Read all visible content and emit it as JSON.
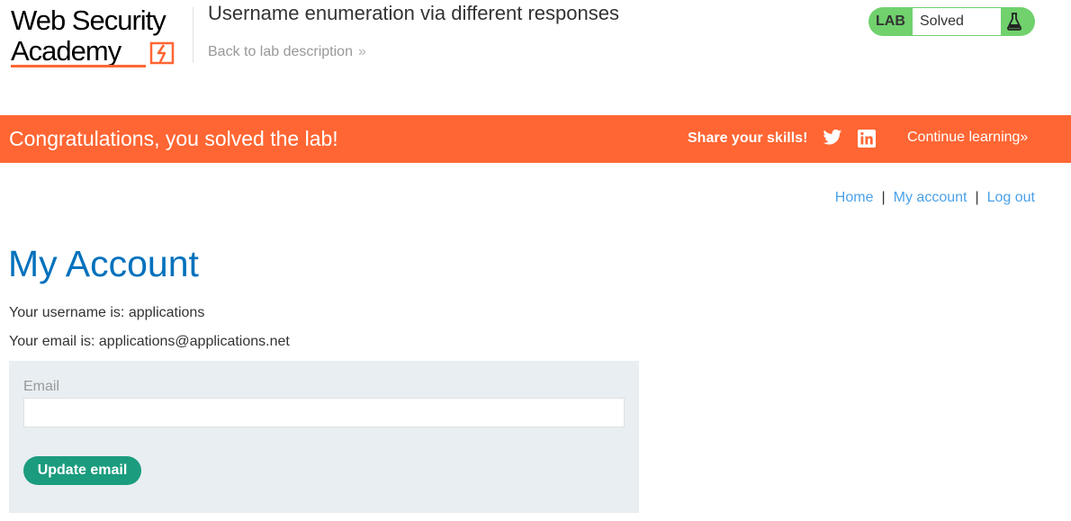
{
  "header": {
    "logo_line1": "Web Security",
    "logo_line2": "Academy",
    "lab_title": "Username enumeration via different responses",
    "back_link": "Back to lab description",
    "back_chevron": "»",
    "lab_status": {
      "tag": "LAB",
      "state": "Solved",
      "icon": "flask-icon"
    }
  },
  "banner": {
    "message": "Congratulations, you solved the lab!",
    "share_label": "Share your skills!",
    "icons": [
      "twitter-icon",
      "linkedin-icon"
    ],
    "continue_label": "Continue learning",
    "continue_chevron": "»"
  },
  "nav": {
    "home": "Home",
    "my_account": "My account",
    "logout": "Log out",
    "separator": "|"
  },
  "main": {
    "title": "My Account",
    "username_text": "Your username is: applications",
    "email_text": "Your email is: applications@applications.net",
    "form": {
      "email_label": "Email",
      "email_value": "",
      "submit_label": "Update email"
    }
  },
  "colors": {
    "accent": "#ff6633",
    "title_blue": "#0071bc",
    "link_blue": "#4aa1e8",
    "button_green": "#1b9c7e",
    "status_green": "#70d16d",
    "form_bg": "#e8eef1"
  }
}
